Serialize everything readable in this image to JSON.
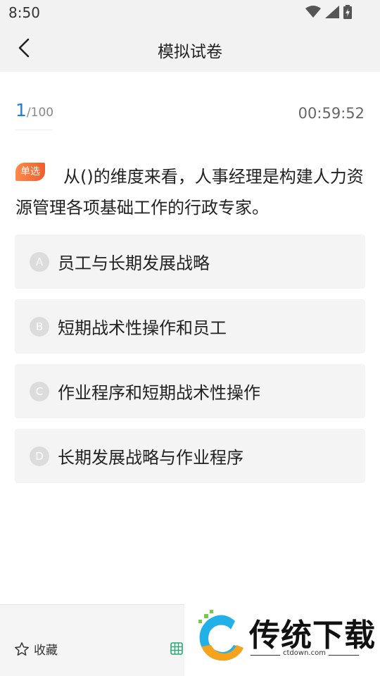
{
  "status_bar": {
    "time": "8:50"
  },
  "header": {
    "title": "模拟试卷"
  },
  "progress": {
    "current": "1",
    "total": "/100"
  },
  "timer": "00:59:52",
  "question": {
    "type": "单选",
    "text": "从()的维度来看，人事经理是构建人力资源管理各项基础工作的行政专家。"
  },
  "options": [
    {
      "letter": "A",
      "text": "员工与长期发展战略"
    },
    {
      "letter": "B",
      "text": "短期战术性操作和员工"
    },
    {
      "letter": "C",
      "text": "作业程序和短期战术性操作"
    },
    {
      "letter": "D",
      "text": "长期发展战略与作业程序"
    }
  ],
  "bottom_bar": {
    "favorite_label": "收藏"
  },
  "watermark": {
    "title": "传统下载",
    "url": "ctdown.com"
  },
  "colors": {
    "accent": "#1e7fe0",
    "badge": "#f26a33"
  }
}
